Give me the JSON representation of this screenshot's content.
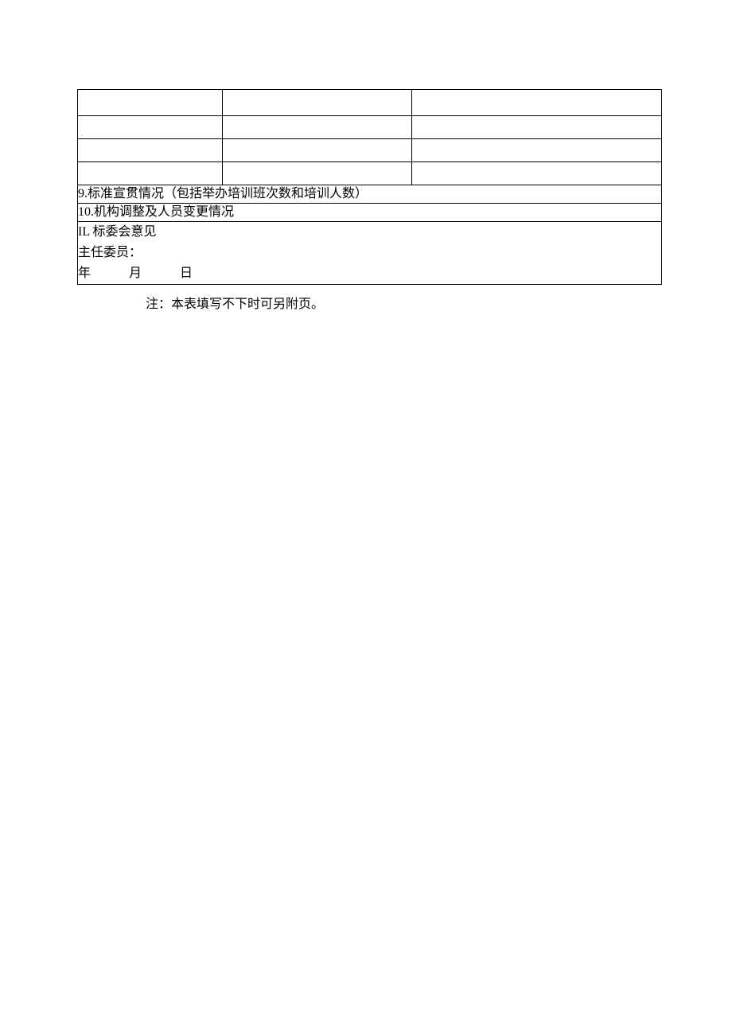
{
  "section9": "9.标准宣贯情况（包括举办培训班次数和培训人数）",
  "section10": "10.机构调整及人员变更情况",
  "section11_title": "IL 标委会意见",
  "section11_chair": "主任委员：",
  "date": {
    "year": "年",
    "month": "月",
    "day": "日"
  },
  "footnote": "注：本表填写不下时可另附页。"
}
